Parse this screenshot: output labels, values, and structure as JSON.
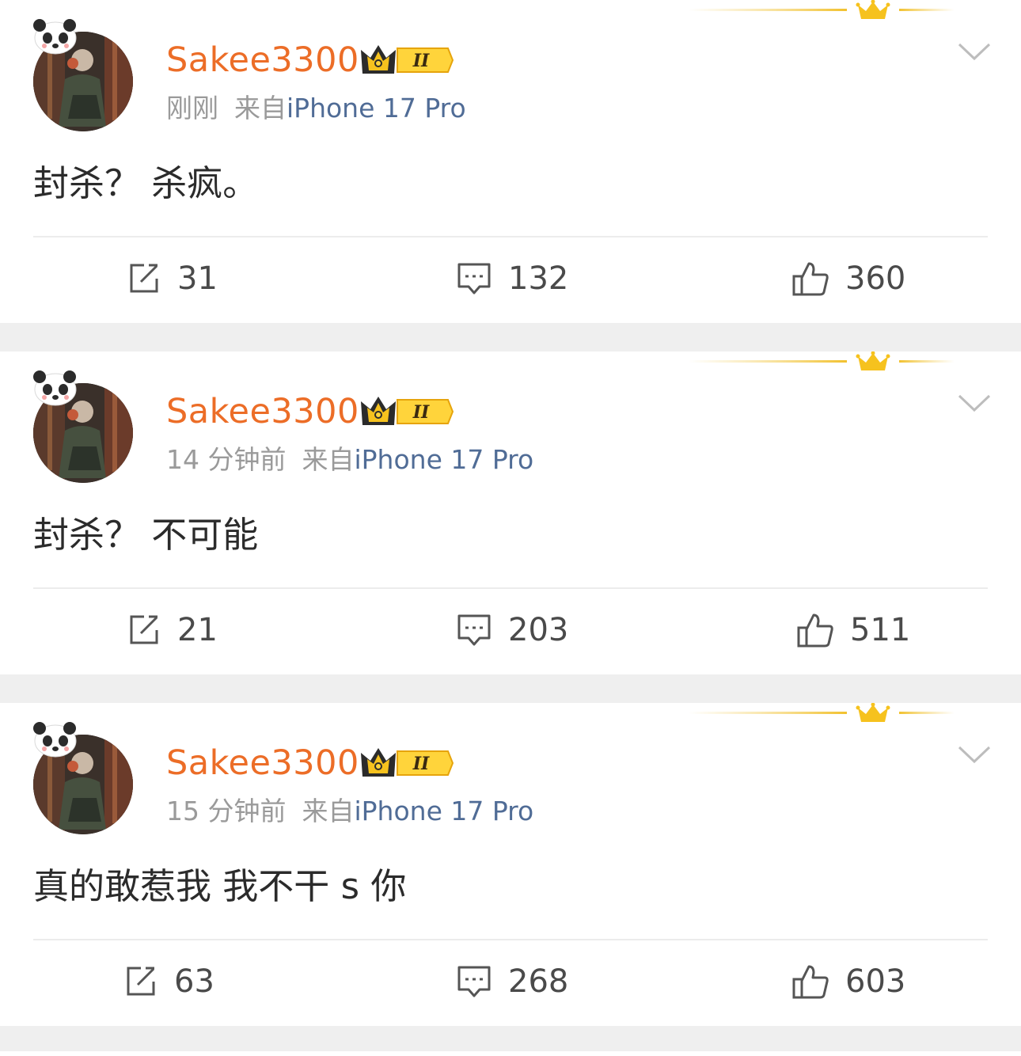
{
  "posts": [
    {
      "username": "Sakee3300",
      "time": "刚刚",
      "source_prefix": "来自",
      "device": "iPhone 17 Pro",
      "content": "封杀？ 杀疯。",
      "reposts": "31",
      "comments": "132",
      "likes": "360"
    },
    {
      "username": "Sakee3300",
      "time": "14 分钟前",
      "source_prefix": "来自",
      "device": "iPhone 17 Pro",
      "content": "封杀？ 不可能",
      "reposts": "21",
      "comments": "203",
      "likes": "511"
    },
    {
      "username": "Sakee3300",
      "time": "15 分钟前",
      "source_prefix": "来自",
      "device": "iPhone 17 Pro",
      "content": "真的敢惹我 我不干 s 你",
      "reposts": "63",
      "comments": "268",
      "likes": "603"
    }
  ],
  "badge": {
    "level": "II"
  },
  "icons": {
    "repost": "repost-icon",
    "comment": "comment-icon",
    "like": "thumbs-up-icon",
    "menu": "chevron-down-icon",
    "crown": "crown-icon",
    "pendant": "panda-pendant-icon"
  },
  "colors": {
    "username": "#ec6d27",
    "device": "#506c96",
    "meta": "#9a9a9a",
    "content": "#2b2b2b",
    "background": "#efefef",
    "card": "#ffffff"
  }
}
